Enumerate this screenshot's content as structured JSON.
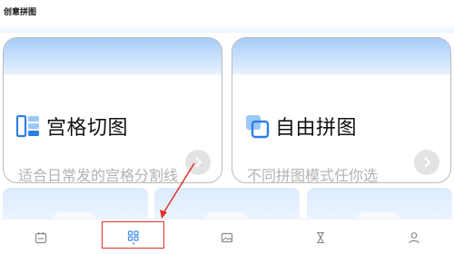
{
  "app": {
    "title": "创意拼图"
  },
  "cards": [
    {
      "title": "宫格切图",
      "subtitle": "适合日常发的宫格分割线",
      "icon": "grid-cut-icon",
      "arrow_icon": "chevron-right-icon"
    },
    {
      "title": "自由拼图",
      "subtitle": "不同拼图模式任你选",
      "icon": "free-collage-icon",
      "arrow_icon": "chevron-right-icon"
    }
  ],
  "bottom_nav": {
    "items": [
      {
        "icon": "calendar-icon"
      },
      {
        "icon": "grid-apps-icon",
        "active": true
      },
      {
        "icon": "image-icon"
      },
      {
        "icon": "hourglass-icon"
      },
      {
        "icon": "user-icon"
      }
    ]
  },
  "colors": {
    "card_band": "#a6ccf8",
    "accent_blue": "#3d8bf0",
    "annotation_red": "#e0322a"
  }
}
